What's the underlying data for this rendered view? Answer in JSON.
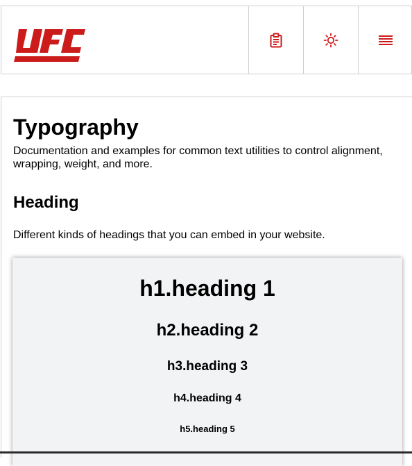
{
  "brand": {
    "logo_text": "UFC",
    "color": "#cc1b1b"
  },
  "header": {
    "icons": [
      "clipboard-icon",
      "sun-icon",
      "menu-icon"
    ]
  },
  "page": {
    "title": "Typography",
    "description": "Documentation and examples for common text utilities to control alignment, wrapping, weight, and more."
  },
  "section": {
    "title": "Heading",
    "description": "Different kinds of headings that you can embed in your website.",
    "headings": [
      "h1.heading 1",
      "h2.heading 2",
      "h3.heading 3",
      "h4.heading 4",
      "h5.heading 5"
    ]
  }
}
